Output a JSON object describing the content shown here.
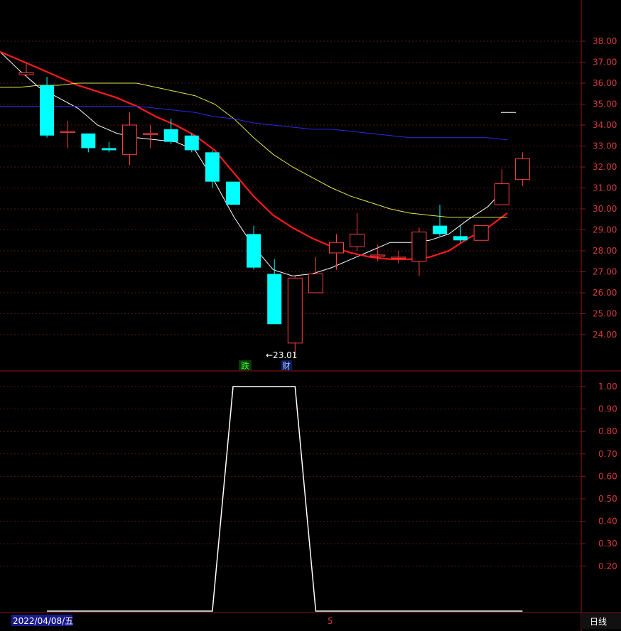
{
  "colors": {
    "background": "#000000",
    "axis": "#8b1a1a",
    "grid": "#5a1515",
    "tick_text": "#d23c3c",
    "candle_up": "#ff4040",
    "candle_down": "#00ffff",
    "ma_white": "#ffffff",
    "ma_red": "#ff1a1a",
    "ma_yellow": "#e6e64a",
    "ma_blue": "#2a2ae6",
    "indicator": "#ffffff"
  },
  "chart_data": [
    {
      "type": "candlestick",
      "ylim": [
        23.0,
        39.0
      ],
      "yticks": [
        "38.00",
        "37.00",
        "36.00",
        "35.00",
        "34.00",
        "33.00",
        "32.00",
        "31.00",
        "30.00",
        "29.00",
        "28.00",
        "27.00",
        "26.00",
        "25.00",
        "24.00"
      ],
      "ytick_values": [
        38,
        37,
        36,
        35,
        34,
        33,
        32,
        31,
        30,
        29,
        28,
        27,
        26,
        25,
        24
      ],
      "grid": true,
      "candles": [
        {
          "o": 36.4,
          "c": 36.5,
          "h": 37.0,
          "l": 36.3
        },
        {
          "o": 35.9,
          "c": 33.5,
          "h": 36.3,
          "l": 33.4
        },
        {
          "o": 33.7,
          "c": 33.7,
          "h": 34.2,
          "l": 32.9
        },
        {
          "o": 33.6,
          "c": 32.9,
          "h": 33.6,
          "l": 32.7
        },
        {
          "o": 32.9,
          "c": 32.8,
          "h": 33.2,
          "l": 32.7
        },
        {
          "o": 32.6,
          "c": 34.0,
          "h": 34.6,
          "l": 32.1
        },
        {
          "o": 33.6,
          "c": 33.6,
          "h": 34.0,
          "l": 32.9
        },
        {
          "o": 33.8,
          "c": 33.2,
          "h": 34.3,
          "l": 33.1
        },
        {
          "o": 33.5,
          "c": 32.8,
          "h": 33.6,
          "l": 32.7
        },
        {
          "o": 32.7,
          "c": 31.3,
          "h": 32.8,
          "l": 31.0
        },
        {
          "o": 31.3,
          "c": 30.2,
          "h": 31.3,
          "l": 30.2
        },
        {
          "o": 28.8,
          "c": 27.2,
          "h": 29.2,
          "l": 27.1
        },
        {
          "o": 26.9,
          "c": 24.5,
          "h": 27.6,
          "l": 24.5
        },
        {
          "o": 23.6,
          "c": 26.7,
          "h": 26.8,
          "l": 23.01
        },
        {
          "o": 26.0,
          "c": 26.9,
          "h": 27.7,
          "l": 26.0
        },
        {
          "o": 27.9,
          "c": 28.4,
          "h": 28.8,
          "l": 27.1
        },
        {
          "o": 28.2,
          "c": 28.8,
          "h": 29.8,
          "l": 28.0
        },
        {
          "o": 27.8,
          "c": 27.8,
          "h": 28.3,
          "l": 27.5
        },
        {
          "o": 27.7,
          "c": 27.7,
          "h": 28.0,
          "l": 27.4
        },
        {
          "o": 27.5,
          "c": 28.9,
          "h": 29.1,
          "l": 26.8
        },
        {
          "o": 29.2,
          "c": 28.8,
          "h": 30.2,
          "l": 28.7
        },
        {
          "o": 28.7,
          "c": 28.5,
          "h": 29.2,
          "l": 28.4
        },
        {
          "o": 28.5,
          "c": 29.2,
          "h": 29.2,
          "l": 28.5
        },
        {
          "o": 30.2,
          "c": 31.2,
          "h": 31.9,
          "l": 30.2
        },
        {
          "o": 31.4,
          "c": 32.4,
          "h": 32.7,
          "l": 31.1
        }
      ],
      "series": [
        {
          "color": "#ffffff",
          "values": [
            37.5,
            36.6,
            35.8,
            35.3,
            34.8,
            34.0,
            33.6,
            33.4,
            33.3,
            33.2,
            32.8,
            31.3,
            29.6,
            28.2,
            27.1,
            26.8,
            26.9,
            27.2,
            27.6,
            28.0,
            28.4,
            28.4,
            28.5,
            28.8,
            29.5,
            30.1,
            31.1
          ]
        },
        {
          "color": "#ff1a1a",
          "values": [
            37.5,
            37.1,
            36.7,
            36.3,
            35.9,
            35.6,
            35.3,
            34.9,
            34.4,
            34.0,
            33.5,
            32.8,
            31.7,
            30.6,
            29.7,
            29.1,
            28.6,
            28.2,
            27.9,
            27.7,
            27.6,
            27.6,
            27.7,
            28.0,
            28.6,
            29.1,
            29.8
          ]
        },
        {
          "color": "#e6e64a",
          "values": [
            35.8,
            35.8,
            35.9,
            35.9,
            36.0,
            36.0,
            36.0,
            36.0,
            35.8,
            35.6,
            35.4,
            35.0,
            34.3,
            33.4,
            32.6,
            32.0,
            31.5,
            31.0,
            30.6,
            30.3,
            30.0,
            29.8,
            29.7,
            29.6,
            29.6,
            29.6,
            29.6
          ]
        },
        {
          "color": "#2a2ae6",
          "values": [
            34.9,
            34.9,
            34.9,
            34.9,
            34.9,
            34.9,
            34.9,
            34.9,
            34.8,
            34.7,
            34.6,
            34.4,
            34.3,
            34.1,
            34.0,
            33.9,
            33.8,
            33.8,
            33.7,
            33.6,
            33.5,
            33.4,
            33.4,
            33.4,
            33.4,
            33.4,
            33.3
          ]
        }
      ],
      "annotations": {
        "low_label": "←23.01",
        "marker_1": "跌",
        "marker_2": "财"
      },
      "last_price_marker": 34.6
    },
    {
      "type": "line",
      "ylim": [
        0.0,
        1.05
      ],
      "yticks": [
        "1.00",
        "0.90",
        "0.80",
        "0.70",
        "0.60",
        "0.50",
        "0.40",
        "0.30",
        "0.20"
      ],
      "ytick_values": [
        1.0,
        0.9,
        0.8,
        0.7,
        0.6,
        0.5,
        0.4,
        0.3,
        0.2
      ],
      "grid": true,
      "series": [
        {
          "color": "#ffffff",
          "values": [
            0,
            0,
            0,
            0,
            0,
            0,
            0,
            0,
            0,
            0,
            1,
            1,
            1,
            1,
            0,
            0,
            0,
            0,
            0,
            0,
            0,
            0,
            0,
            0,
            0
          ]
        }
      ]
    }
  ],
  "footer": {
    "date": "2022/04/08/五",
    "mid_marker": "5",
    "period": "日线"
  }
}
